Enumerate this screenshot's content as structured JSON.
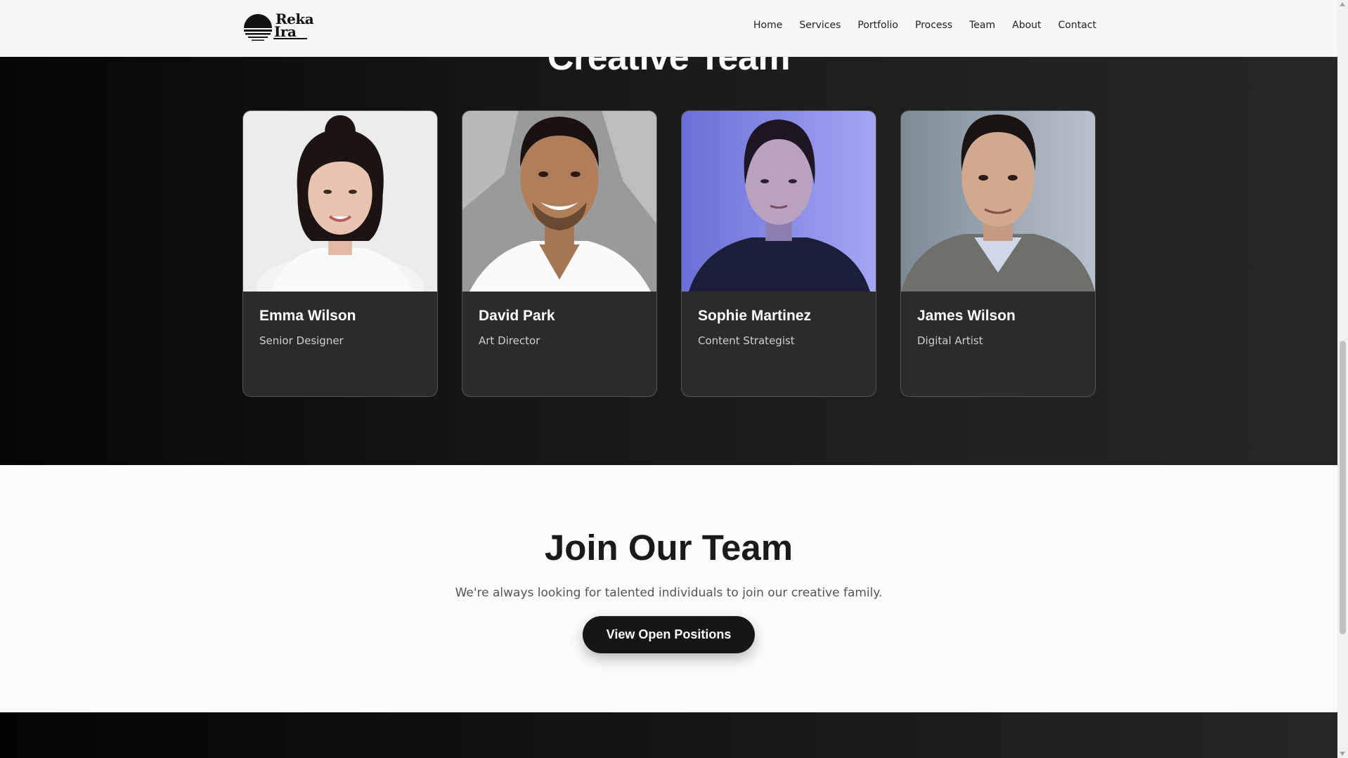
{
  "header": {
    "logo": {
      "line1": "Reka",
      "line2": "Ira"
    },
    "nav": [
      "Home",
      "Services",
      "Portfolio",
      "Process",
      "Team",
      "About",
      "Contact"
    ]
  },
  "team": {
    "title": "Creative Team",
    "members": [
      {
        "name": "Emma Wilson",
        "role": "Senior Designer"
      },
      {
        "name": "David Park",
        "role": "Art Director"
      },
      {
        "name": "Sophie Martinez",
        "role": "Content Strategist"
      },
      {
        "name": "James Wilson",
        "role": "Digital Artist"
      }
    ]
  },
  "join": {
    "title": "Join Our Team",
    "description": "We're always looking for talented individuals to join our creative family.",
    "button_label": "View Open Positions"
  }
}
